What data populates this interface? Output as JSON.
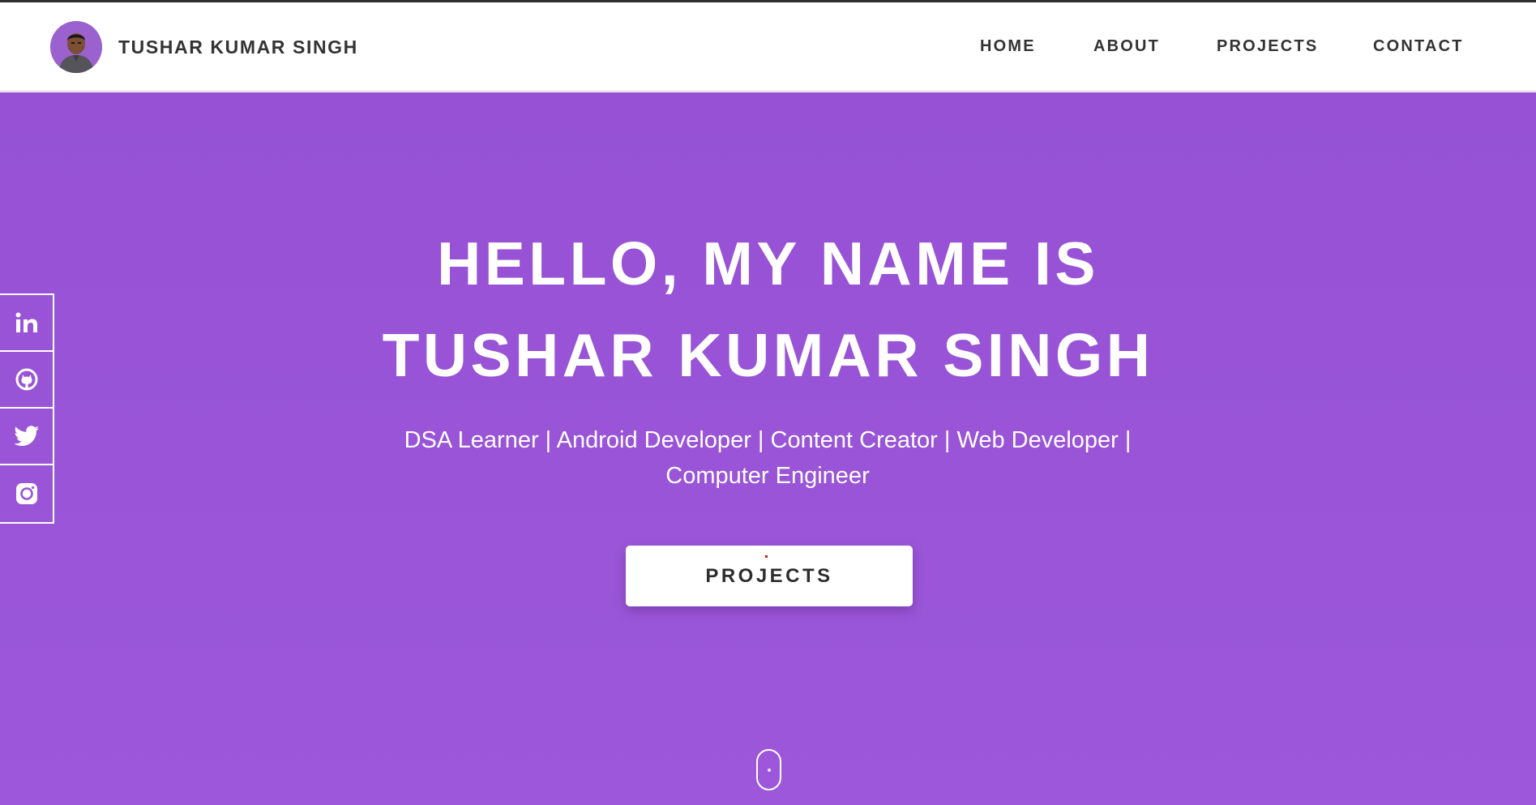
{
  "header": {
    "brand_name": "TUSHAR KUMAR SINGH",
    "nav": [
      {
        "label": "HOME"
      },
      {
        "label": "ABOUT"
      },
      {
        "label": "PROJECTS"
      },
      {
        "label": "CONTACT"
      }
    ]
  },
  "hero": {
    "title_line1": "HELLO, MY NAME IS",
    "title_line2": "TUSHAR KUMAR SINGH",
    "subtitle": "DSA Learner | Android Developer | Content Creator | Web Developer | Computer Engineer",
    "cta_label": "PROJECTS"
  },
  "social": [
    {
      "icon": "linkedin-icon"
    },
    {
      "icon": "github-icon"
    },
    {
      "icon": "twitter-icon"
    },
    {
      "icon": "instagram-icon"
    }
  ],
  "colors": {
    "hero_background": "#9a55d8",
    "header_background": "#ffffff",
    "text_dark": "#333333",
    "text_light": "#ffffff"
  }
}
